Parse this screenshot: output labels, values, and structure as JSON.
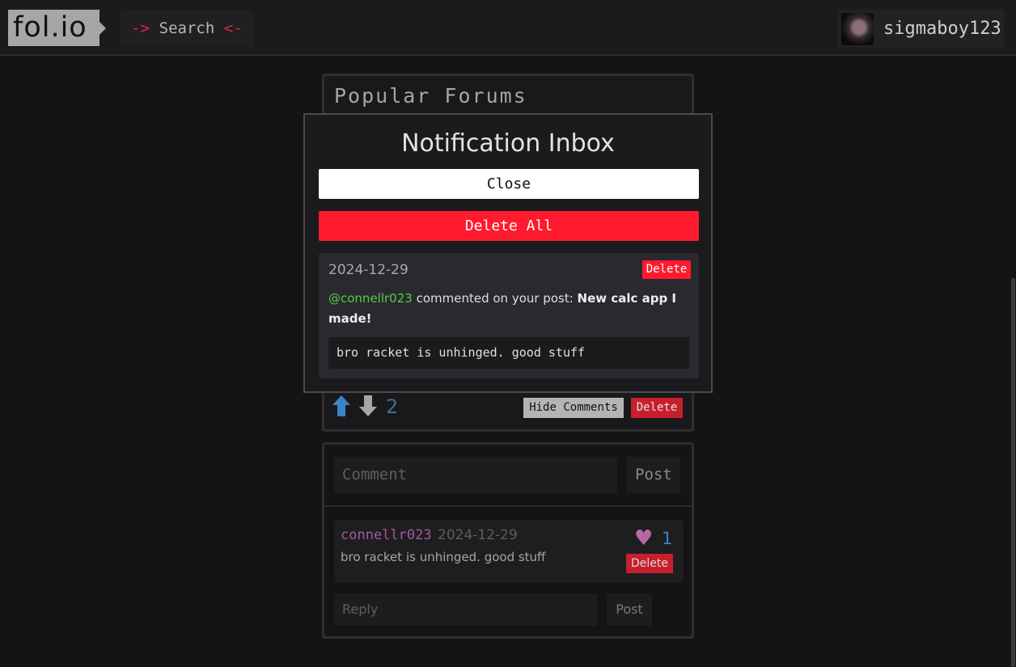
{
  "header": {
    "logo": "fol.io",
    "search_prefix": "->",
    "search_label": "Search",
    "search_suffix": "<-",
    "username": "sigmaboy123"
  },
  "card": {
    "title": "Popular Forums",
    "vote_count": "2",
    "hide_comments_label": "Hide Comments",
    "delete_label": "Delete"
  },
  "comments": {
    "input_placeholder": "Comment",
    "post_label": "Post",
    "items": [
      {
        "user": "connellr023",
        "date": "2024-12-29",
        "text": "bro racket is unhinged. good stuff",
        "likes": "1",
        "delete_label": "Delete"
      }
    ],
    "reply_placeholder": "Reply",
    "reply_post_label": "Post"
  },
  "modal": {
    "title": "Notification Inbox",
    "close_label": "Close",
    "delete_all_label": "Delete All",
    "notifications": [
      {
        "date": "2024-12-29",
        "delete_label": "Delete",
        "user": "@connellr023",
        "action": " commented on your post: ",
        "post_title": "New calc app I made!",
        "quote": "bro racket is unhinged. good stuff"
      }
    ]
  },
  "colors": {
    "accent_red": "#ff1a2e",
    "mention_green": "#55cc4a",
    "vote_blue": "#3b84c3",
    "comment_user_purple": "#a8579a"
  }
}
